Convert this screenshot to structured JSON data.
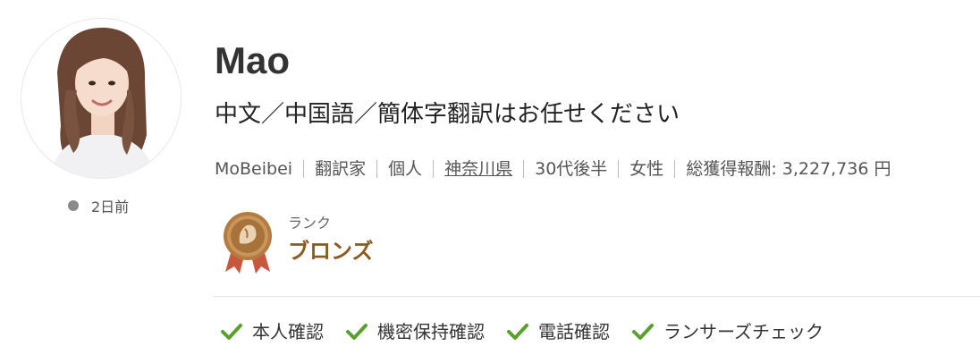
{
  "profile": {
    "name": "Mao",
    "catchphrase": "中文／中国語／簡体字翻訳はお任せください",
    "last_seen": "2日前",
    "meta": {
      "username": "MoBeibei",
      "occupation": "翻訳家",
      "type": "個人",
      "location": "神奈川県",
      "age": "30代後半",
      "gender": "女性",
      "earnings": "総獲得報酬: 3,227,736 円"
    },
    "rank": {
      "label": "ランク",
      "value": "ブロンズ"
    },
    "verifications": [
      {
        "label": "本人確認",
        "icon": "check-icon"
      },
      {
        "label": "機密保持確認",
        "icon": "check-icon"
      },
      {
        "label": "電話確認",
        "icon": "check-icon"
      },
      {
        "label": "ランサーズチェック",
        "icon": "check-icon"
      }
    ]
  },
  "colors": {
    "rank_text": "#8a5a22",
    "check": "#5aa02c",
    "status_dot": "#8a8a8a",
    "medal": "#a8733a"
  }
}
